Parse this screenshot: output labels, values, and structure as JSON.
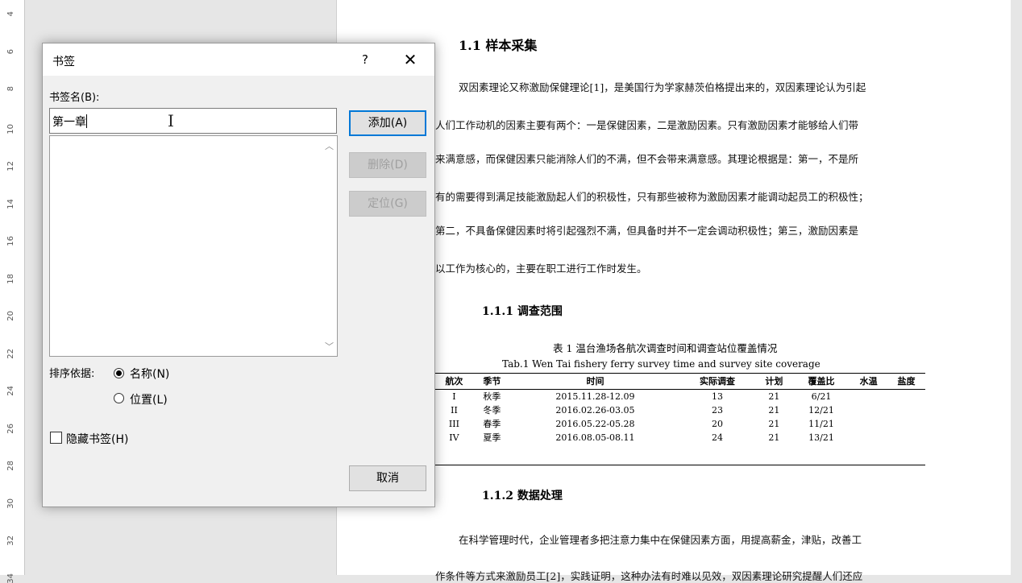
{
  "ruler": {
    "marks": [
      "4",
      "6",
      "8",
      "10",
      "12",
      "14",
      "16",
      "18",
      "20",
      "22",
      "24",
      "26",
      "28",
      "30",
      "32",
      "34"
    ]
  },
  "document": {
    "heading_1_1": "1.1 样本采集",
    "para1": [
      "双因素理论又称激励保健理论[1]，是美国行为学家赫茨伯格提出来的，双因素理论认为引起",
      "人们工作动机的因素主要有两个：一是保健因素，二是激励因素。只有激励因素才能够给人们带",
      "来满意感，而保健因素只能消除人们的不满，但不会带来满意感。其理论根据是：第一，不是所",
      "有的需要得到满足技能激励起人们的积极性，只有那些被称为激励因素才能调动起员工的积极性；",
      "第二，不具备保健因素时将引起强烈不满，但具备时并不一定会调动积极性；第三，激励因素是",
      "以工作为核心的，主要在职工进行工作时发生。"
    ],
    "heading_1_1_1": "1.1.1 调查范围",
    "table_caption_cn": "表 1  温台渔场各航次调查时间和调查站位覆盖情况",
    "table_caption_en": "Tab.1  Wen Tai fishery ferry survey time and survey site coverage",
    "table": {
      "headers": [
        "航次",
        "季节",
        "时间",
        "实际调查",
        "计划",
        "覆盖比",
        "水温",
        "盐度"
      ],
      "rows": [
        [
          "I",
          "秋季",
          "2015.11.28-12.09",
          "13",
          "21",
          "6/21",
          "",
          ""
        ],
        [
          "II",
          "冬季",
          "2016.02.26-03.05",
          "23",
          "21",
          "12/21",
          "",
          ""
        ],
        [
          "III",
          "春季",
          "2016.05.22-05.28",
          "20",
          "21",
          "11/21",
          "",
          ""
        ],
        [
          "IV",
          "夏季",
          "2016.08.05-08.11",
          "24",
          "21",
          "13/21",
          "",
          ""
        ]
      ]
    },
    "heading_1_1_2": "1.1.2 数据处理",
    "para2": [
      "在科学管理时代，企业管理者多把注意力集中在保健因素方面，用提高薪金，津贴，改善工",
      "作条件等方式来激励员工[2]，实践证明，这种办法有时难以见效，双因素理论研究提醒人们还应"
    ]
  },
  "dialog": {
    "title": "书签",
    "help": "?",
    "close": "✕",
    "name_label": "书签名(B):",
    "name_value": "第一章",
    "buttons": {
      "add": "添加(A)",
      "delete": "删除(D)",
      "goto": "定位(G)",
      "cancel": "取消"
    },
    "sort_label": "排序依据:",
    "sort_options": {
      "name": "名称(N)",
      "position": "位置(L)",
      "selected": "name"
    },
    "hidden_label": "隐藏书签(H)",
    "hidden_checked": false,
    "accent_color": "#0078d7"
  }
}
